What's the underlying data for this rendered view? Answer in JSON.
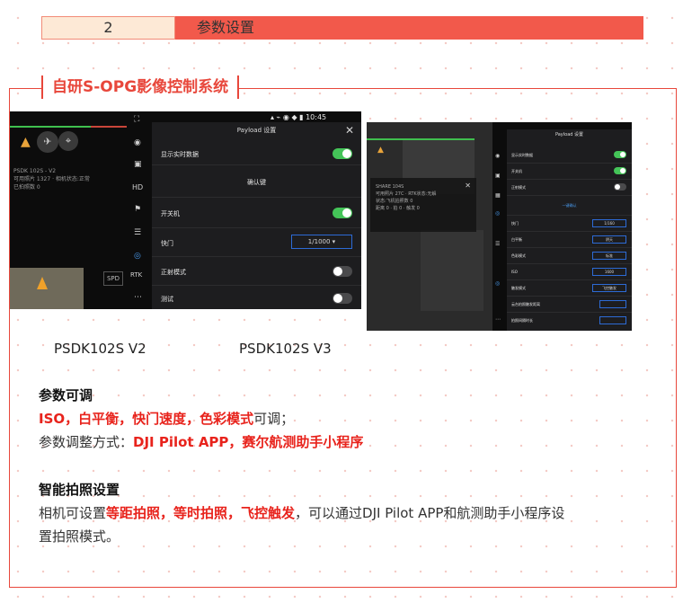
{
  "header": {
    "number": "2",
    "title": "参数设置"
  },
  "section_title": "自研S-OPG影像控制系统",
  "screen_v2": {
    "time": "10:45",
    "panel_title": "Payload 设置",
    "close": "✕",
    "rows": [
      {
        "label": "显示实时数据",
        "toggle": "on"
      },
      {
        "label": "确认键",
        "toggle": ""
      },
      {
        "label": "开关机",
        "toggle": "on"
      },
      {
        "label": "快门",
        "select": "1/1000"
      },
      {
        "label": "正射模式",
        "toggle": "off"
      },
      {
        "label": "测试",
        "toggle": "off"
      }
    ],
    "side_labels": [
      "HD",
      "RTK",
      "SPD"
    ],
    "overlay_text": [
      "PSDK 102S - V2",
      "可用照片 1327 · 相机状态:正常",
      "已拍照数 0"
    ]
  },
  "screen_v3": {
    "panel_title": "Payload 设置",
    "rows": [
      {
        "label": "显示实时数据",
        "toggle": "on"
      },
      {
        "label": "开关机",
        "toggle": "on"
      },
      {
        "label": "正射模式",
        "toggle": "off"
      },
      {
        "label": "一键确认",
        "link": true
      },
      {
        "label": "快门",
        "select": "1/160"
      },
      {
        "label": "白平衡",
        "select": "阴天"
      },
      {
        "label": "色彩模式",
        "select": "标准"
      },
      {
        "label": "ISO",
        "select": "1600"
      },
      {
        "label": "触发模式",
        "select": "飞控触发"
      },
      {
        "label": "云台拍照触发距离",
        "value": ""
      },
      {
        "label": "拍照间隔时长",
        "value": ""
      }
    ],
    "overlay_text": [
      "SHARE 104S",
      "可用照片 27C · RTK状态:无解",
      "状态:飞机拍照数 0",
      "距离 0 · 拍 0 · 触发 0"
    ]
  },
  "captions": {
    "v2": "PSDK102S V2",
    "v3": "PSDK102S V3"
  },
  "block1": {
    "heading": "参数可调",
    "line1_red": "ISO，白平衡，快门速度，色彩模式",
    "line1_rest": "可调；",
    "line2_prefix": "参数调整方式：",
    "line2_red": "DJI Pilot APP，赛尔航测助手小程序"
  },
  "block2": {
    "heading": "智能拍照设置",
    "prefix": "相机可设置",
    "red": "等距拍照，等时拍照，飞控触发",
    "rest1": "，可以通过DJI Pilot APP和航测助手小程序设",
    "rest2": "置拍照模式。"
  },
  "colors": {
    "accent": "#e8473b",
    "bar": "#f2594b",
    "red_text": "#e8231c",
    "toggle_on": "#44c458"
  }
}
